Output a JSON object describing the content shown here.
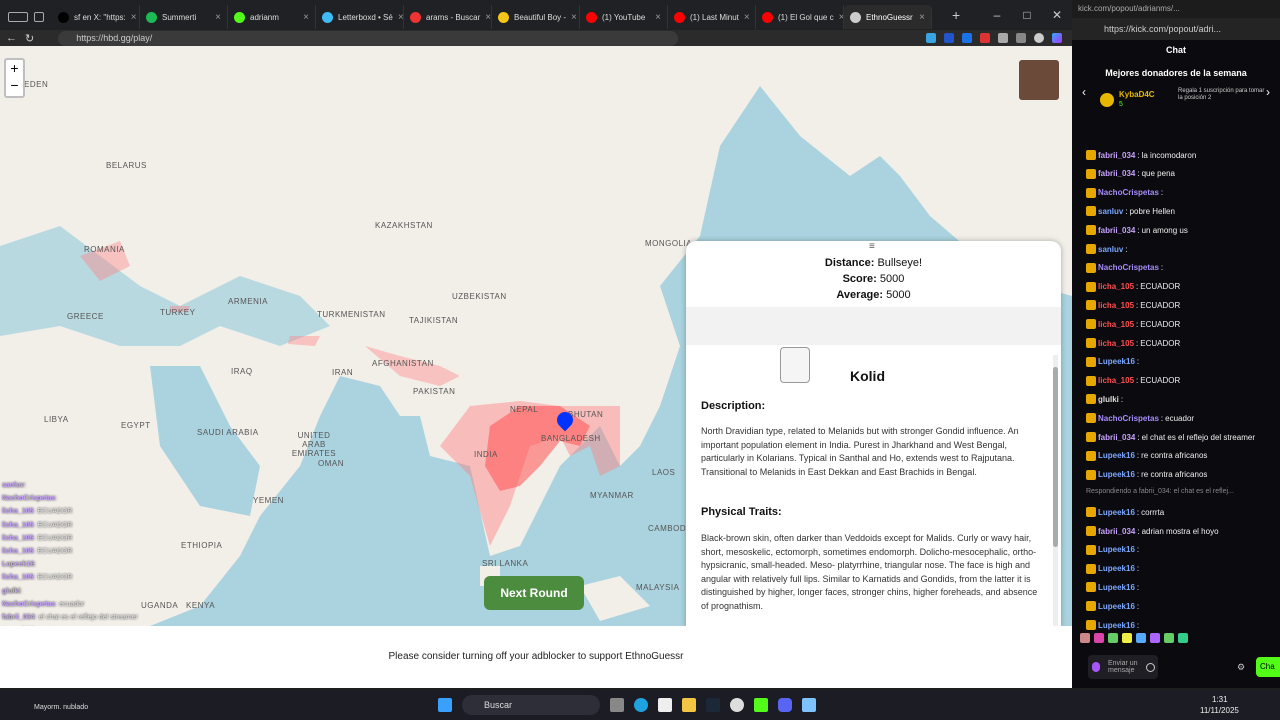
{
  "browser": {
    "tabs": [
      {
        "label": "sf en X: \"https:",
        "color": "#000000",
        "icon": "x-logo-icon"
      },
      {
        "label": "Summerti",
        "color": "#1db954",
        "icon": "spotify-icon"
      },
      {
        "label": "adrianm",
        "color": "#53fc18",
        "icon": "kick-icon"
      },
      {
        "label": "Letterboxd • Sé",
        "color": "#40bcf4",
        "icon": "letterboxd-icon"
      },
      {
        "label": "arams - Buscar",
        "color": "#e33",
        "icon": "search-tab-icon"
      },
      {
        "label": "Beautiful Boy -",
        "color": "#f5c518",
        "icon": "imdb-icon"
      },
      {
        "label": "(1) YouTube",
        "color": "#ff0000",
        "icon": "youtube-icon"
      },
      {
        "label": "(1) Last Minut",
        "color": "#ff0000",
        "icon": "youtube-icon"
      },
      {
        "label": "(1) El Gol que c",
        "color": "#ff0000",
        "icon": "youtube-icon"
      },
      {
        "label": "EthnoGuessr",
        "color": "#cccccc",
        "icon": "ethnoguessr-icon",
        "active": true
      }
    ],
    "url": "https://hbd.gg/play/"
  },
  "map": {
    "labels": [
      "EDEN",
      "BELARUS",
      "ROMANIA",
      "KAZAKHSTAN",
      "MONGOLIA",
      "TURKEY",
      "ARMENIA",
      "UZBEKISTAN",
      "GREECE",
      "TURKMENISTAN",
      "TAJIKISTAN",
      "IRAQ",
      "IRAN",
      "AFGHANISTAN",
      "PAKISTAN",
      "NEPAL",
      "BHUTAN",
      "LIBYA",
      "EGYPT",
      "SAUDI ARABIA",
      "UNITED ARAB EMIRATES",
      "OMAN",
      "INDIA",
      "BANGLADESH",
      "LAOS",
      "MYANMAR",
      "YEMEN",
      "CAMBOD",
      "ETHIOPIA",
      "SRI LANKA",
      "MALAYSIA",
      "KENYA",
      "UGANDA"
    ],
    "zoom_in": "+",
    "zoom_out": "−"
  },
  "result": {
    "distance_label": "Distance:",
    "distance_value": "Bullseye!",
    "score_label": "Score:",
    "score_value": "5000",
    "average_label": "Average:",
    "average_value": "5000",
    "menu_glyph": "≡",
    "type_name": "Kolid",
    "description_heading": "Description:",
    "description_text": "North Dravidian type, related to Melanids but with stronger Gondid influence. An important population element in India. Purest in Jharkhand and West Bengal, particularly in Kolarians. Typical in Santhal and Ho, extends west to Rajputana. Transitional to Melanids in East Dekkan and East Brachids in Bengal.",
    "traits_heading": "Physical Traits:",
    "traits_text": "Black-brown skin, often darker than Veddoids except for Malids. Curly or wavy hair, short, mesoskelic, ectomorph, sometimes endomorph. Dolicho-mesocephalic, ortho- hypsicranic, small-headed. Meso- platyrrhine, triangular nose. The face is high and angular with relatively full lips. Similar to Karnatids and Gondids, from the latter it is distinguished by higher, longer faces, stronger chins, higher foreheads, and absence of prognathism."
  },
  "next_round": "Next Round",
  "ad_message": "Please consider turning off your adblocker to support EthnoGuessr",
  "kick": {
    "url_top": "kick.com/popout/adrianms/...",
    "url": "https://kick.com/popout/adri...",
    "chat_title": "Chat",
    "donors_title": "Mejores donadores de la semana",
    "donor_name": "KybaD4C",
    "donor_count": "5",
    "donor_msg": "Regala 1 suscripción para tomar la posición 2",
    "messages": [
      {
        "user": "fabrii_034",
        "text": "la incomodaron",
        "color": "#c8a2ff"
      },
      {
        "user": "fabrii_034",
        "text": "que pena",
        "color": "#c8a2ff"
      },
      {
        "user": "NachoCrispetas",
        "text": "",
        "color": "#a78bfa"
      },
      {
        "user": "sanluv",
        "text": "pobre Hellen",
        "color": "#7aa7ff"
      },
      {
        "user": "fabrii_034",
        "text": "un among us",
        "color": "#c8a2ff"
      },
      {
        "user": "sanluv",
        "text": "",
        "color": "#7aa7ff"
      },
      {
        "user": "NachoCrispetas",
        "text": "",
        "color": "#a78bfa"
      },
      {
        "user": "licha_105",
        "text": "ECUADOR",
        "color": "#ff4d4d"
      },
      {
        "user": "licha_105",
        "text": "ECUADOR",
        "color": "#ff4d4d"
      },
      {
        "user": "licha_105",
        "text": "ECUADOR",
        "color": "#ff4d4d"
      },
      {
        "user": "licha_105",
        "text": "ECUADOR",
        "color": "#ff4d4d"
      },
      {
        "user": "Lupeek16",
        "text": "",
        "color": "#7aa7ff"
      },
      {
        "user": "licha_105",
        "text": "ECUADOR",
        "color": "#ff4d4d"
      },
      {
        "user": "glulki",
        "text": "",
        "color": "#dddddd"
      },
      {
        "user": "NachoCrispetas",
        "text": "ecuador",
        "color": "#a78bfa"
      },
      {
        "user": "fabrii_034",
        "text": "el chat es el reflejo del streamer",
        "color": "#c8a2ff"
      },
      {
        "user": "Lupeek16",
        "text": "re contra africanos",
        "color": "#7aa7ff"
      },
      {
        "user": "Lupeek16",
        "text": "re contra africanos",
        "color": "#7aa7ff"
      },
      {
        "user": "",
        "text": "Respondiendo a fabrii_034: el chat es el reflej...",
        "color": "#888888"
      },
      {
        "user": "Lupeek16",
        "text": "corrrta",
        "color": "#7aa7ff"
      },
      {
        "user": "fabrii_034",
        "text": "adrian mostra el hoyo",
        "color": "#c8a2ff"
      },
      {
        "user": "Lupeek16",
        "text": "",
        "color": "#7aa7ff"
      },
      {
        "user": "Lupeek16",
        "text": "",
        "color": "#7aa7ff"
      },
      {
        "user": "Lupeek16",
        "text": "",
        "color": "#7aa7ff"
      },
      {
        "user": "Lupeek16",
        "text": "",
        "color": "#7aa7ff"
      },
      {
        "user": "Lupeek16",
        "text": "",
        "color": "#7aa7ff"
      }
    ],
    "input_placeholder": "Enviar un mensaje",
    "send_label": "Cha"
  },
  "overlay_chat": [
    {
      "user": "sanluv",
      "text": ""
    },
    {
      "user": "NachoCrispetas",
      "text": ""
    },
    {
      "user": "licha_105",
      "text": "ECUADOR"
    },
    {
      "user": "licha_105",
      "text": "ECUADOR"
    },
    {
      "user": "licha_105",
      "text": "ECUADOR"
    },
    {
      "user": "licha_105",
      "text": "ECUADOR"
    },
    {
      "user": "Lupeek16",
      "text": ""
    },
    {
      "user": "licha_105",
      "text": "ECUADOR"
    },
    {
      "user": "glulki",
      "text": ""
    },
    {
      "user": "NachoCrispetas",
      "text": "ecuador"
    },
    {
      "user": "fabrii_034",
      "text": "el chat es el reflejo del streamer"
    },
    {
      "user": "Lupeek16",
      "text": "corrrta"
    },
    {
      "user": "fabrii_034",
      "text": "adrian mostra el hoyo"
    },
    {
      "user": "Lupeek16",
      "text": ""
    },
    {
      "user": "Lupeek16",
      "text": ""
    },
    {
      "user": "Lupeek16",
      "text": ""
    }
  ],
  "taskbar": {
    "search_placeholder": "Buscar",
    "time": "1:31",
    "date": "11/11/2025",
    "weather": "Mayorm. nublado"
  }
}
